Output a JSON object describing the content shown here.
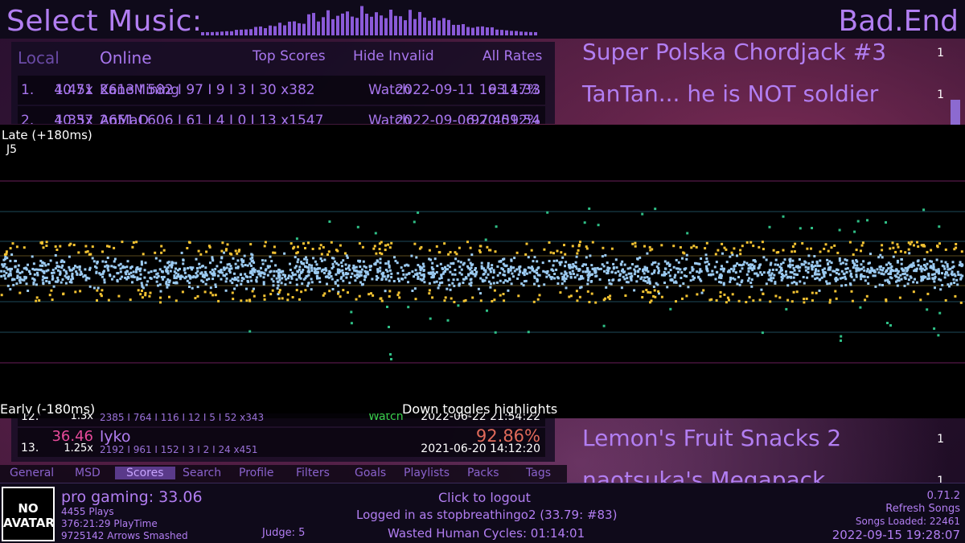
{
  "header": {
    "title": "Select Music:",
    "pack_name": "Bad.End"
  },
  "score_panel": {
    "tabs": {
      "local": "Local",
      "online": "Online",
      "top_scores": "Top Scores",
      "hide_invalid": "Hide Invalid",
      "all_rates": "All Rates"
    },
    "rows": [
      {
        "rank": "1.",
        "ssr": "40.71",
        "rate": "1.45x",
        "name": "KaneMining",
        "judgments": "2613 I 582 I 97 I 9 I 3 I 30   x382",
        "watch": "Watch",
        "date": "2022-09-11 16:14:33",
        "percent": "93.17%"
      },
      {
        "rank": "2.",
        "ssr": "40.37",
        "rate": "1.35x",
        "name": "AnMaO",
        "judgments": "2651 I 606 I 61 I 4 I 0 I 13   x1547",
        "watch": "Watch",
        "date": "2022-09-06 20:01:54",
        "percent": "97.4592%"
      }
    ],
    "lower_rows": [
      {
        "rank": "12.",
        "ssr": "",
        "rate": "1.3x",
        "name": "",
        "judgments": "2385 I 764 I 116 I 12 I 5 I 52   x343",
        "watch": "Watch",
        "date": "2022-06-22 21:54:22",
        "percent": ""
      },
      {
        "rank": "13.",
        "ssr": "36.46",
        "rate": "1.25x",
        "name": "lyko",
        "judgments": "2192 I 961 I 152 I 3 I 2 I 24   x451",
        "watch": "",
        "date": "2021-06-20 14:12:20",
        "percent": "92.86%"
      }
    ]
  },
  "song_wheel": {
    "top": [
      {
        "title": "Super Polska Chordjack #3",
        "count": "1"
      },
      {
        "title": "TanTan... he is NOT soldier",
        "count": "1"
      }
    ],
    "bottom": [
      {
        "title": "Lemon's Fruit Snacks 2",
        "count": "1"
      },
      {
        "title": "naotsuka's Megapack",
        "count": "1"
      }
    ]
  },
  "graph": {
    "late_label": "Late (+180ms)",
    "judge_label": "J5",
    "early_label": "Early (-180ms)",
    "hint": "Down toggles highlights",
    "colors": {
      "marvelous": "#9ccbf2",
      "perfect": "#f2c232",
      "great": "#2fbf86",
      "line_window": "#6a1e5a",
      "line_good": "#1e4a5a"
    }
  },
  "nav_tabs": [
    "General",
    "MSD",
    "Scores",
    "Search",
    "Profile",
    "Filters",
    "Goals",
    "Playlists",
    "Packs",
    "Tags"
  ],
  "active_tab": "Scores",
  "footer": {
    "avatar_text": "NO AVATAR",
    "profile_name": "pro gaming: 33.06",
    "plays": "4455 Plays",
    "playtime": "376:21:29 PlayTime",
    "arrows": "9725142 Arrows Smashed",
    "judge": "Judge: 5",
    "logout": "Click to logout",
    "logged_in": "Logged in as stopbreathingo2 (33.79: #83)",
    "wasted": "Wasted Human Cycles: 01:14:01",
    "version": "0.71.2",
    "refresh": "Refresh Songs",
    "songs_loaded": "Songs Loaded: 22461",
    "clock": "2022-09-15 19:28:07"
  }
}
